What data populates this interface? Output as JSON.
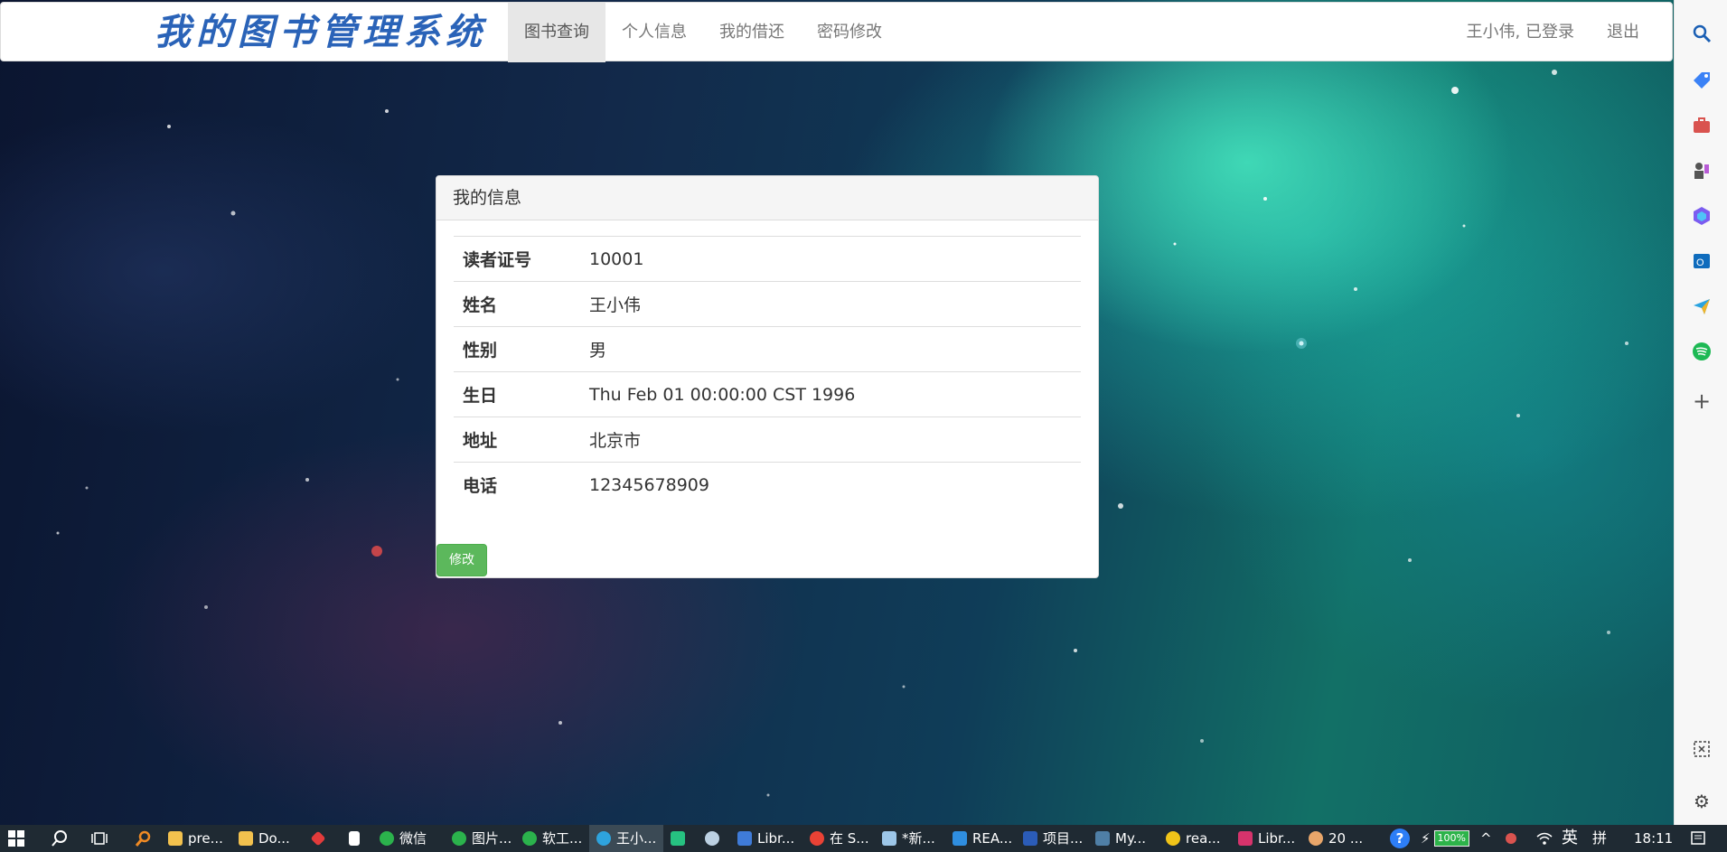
{
  "navbar": {
    "brand": "我的图书管理系统",
    "items": [
      {
        "label": "图书查询",
        "active": true
      },
      {
        "label": "个人信息",
        "active": false
      },
      {
        "label": "我的借还",
        "active": false
      },
      {
        "label": "密码修改",
        "active": false
      }
    ],
    "user_status": "王小伟, 已登录",
    "logout_label": "退出"
  },
  "panel": {
    "title": "我的信息",
    "rows": [
      {
        "label": "读者证号",
        "value": "10001"
      },
      {
        "label": "姓名",
        "value": "王小伟"
      },
      {
        "label": "性别",
        "value": "男"
      },
      {
        "label": "生日",
        "value": "Thu Feb 01 00:00:00 CST 1996"
      },
      {
        "label": "地址",
        "value": "北京市"
      },
      {
        "label": "电话",
        "value": "12345678909"
      }
    ],
    "edit_button": "修改"
  },
  "side_rail": {
    "icons": [
      "search-icon",
      "tag-icon",
      "briefcase-icon",
      "chess-icon",
      "office-icon",
      "outlook-icon",
      "send-icon",
      "spotify-icon",
      "plus-icon",
      "screenshot-icon",
      "gear-icon"
    ]
  },
  "taskbar": {
    "items": [
      {
        "label": "pre...",
        "icon": "folder-icon",
        "color": "#f2c14e"
      },
      {
        "label": "Do...",
        "icon": "folder-icon",
        "color": "#f2c14e"
      },
      {
        "label": "",
        "icon": "diamond-icon",
        "color": "#e23b3b"
      },
      {
        "label": "",
        "icon": "file-icon",
        "color": "#ffffff"
      },
      {
        "label": "微信",
        "icon": "wechat-icon",
        "color": "#2bb24c"
      },
      {
        "label": "图片...",
        "icon": "wechat-icon",
        "color": "#2bb24c"
      },
      {
        "label": "软工...",
        "icon": "wechat-icon",
        "color": "#2bb24c"
      },
      {
        "label": "王小...",
        "icon": "edge-icon",
        "color": "#2ea3dd"
      },
      {
        "label": "",
        "icon": "app-icon",
        "color": "#26c281"
      },
      {
        "label": "",
        "icon": "steam-icon",
        "color": "#bcd1e3"
      },
      {
        "label": "Libr...",
        "icon": "library-icon",
        "color": "#3f7bd8"
      },
      {
        "label": "在 S...",
        "icon": "chrome-icon",
        "color": "#e94235"
      },
      {
        "label": "*新...",
        "icon": "notepad-icon",
        "color": "#9cc6e8"
      },
      {
        "label": "REA...",
        "icon": "vscode-icon",
        "color": "#2f8ee0"
      },
      {
        "label": "项目...",
        "icon": "word-icon",
        "color": "#2b5cb8"
      },
      {
        "label": "My...",
        "icon": "mysql-icon",
        "color": "#4f7fa6"
      },
      {
        "label": "rea...",
        "icon": "typora-icon",
        "color": "#f0c419"
      },
      {
        "label": "Libr...",
        "icon": "idea-icon",
        "color": "#d6336c"
      },
      {
        "label": "20 ...",
        "icon": "avatar-icon",
        "color": "#e8a66a"
      }
    ],
    "battery": "100%",
    "ime": "英",
    "ime2": "拼",
    "time": "18:11"
  }
}
